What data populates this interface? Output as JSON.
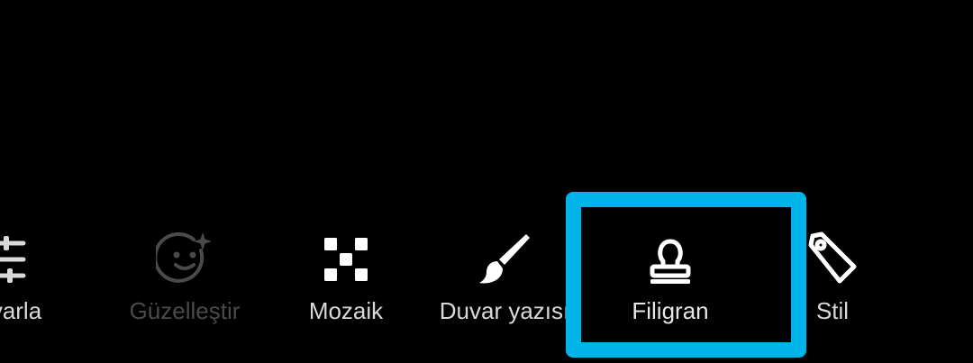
{
  "toolbar": {
    "accent_color": "#00b3e8",
    "items": [
      {
        "label": "yarla",
        "icon": "sliders-icon",
        "state": "partial"
      },
      {
        "label": "Güzelleştir",
        "icon": "beautify-face-icon",
        "state": "disabled"
      },
      {
        "label": "Mozaik",
        "icon": "mosaic-icon",
        "state": "normal"
      },
      {
        "label": "Duvar yazısı",
        "icon": "brush-icon",
        "state": "normal"
      },
      {
        "label": "Filigran",
        "icon": "stamp-icon",
        "state": "highlighted"
      },
      {
        "label": "Stil",
        "icon": "tag-icon",
        "state": "normal"
      }
    ]
  }
}
